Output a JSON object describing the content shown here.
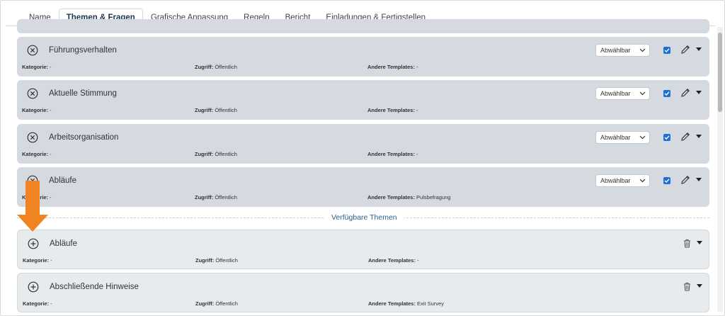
{
  "tabs": [
    {
      "label": "Name"
    },
    {
      "label": "Themen & Fragen"
    },
    {
      "label": "Grafische Anpassung"
    },
    {
      "label": "Regeln"
    },
    {
      "label": "Bericht"
    },
    {
      "label": "Einladungen & Fertigstellen"
    }
  ],
  "active_tab": "Themen & Fragen",
  "labels": {
    "kategorie": "Kategorie:",
    "zugriff": "Zugriff:",
    "andere_templates": "Andere Templates:"
  },
  "selected_topics": [
    {
      "title": "Führungsverhalten",
      "kategorie": " -",
      "zugriff": " Öffentlich",
      "andere_templates": " -",
      "option": "Abwählbar",
      "checked": true
    },
    {
      "title": "Aktuelle Stimmung",
      "kategorie": " -",
      "zugriff": " Öffentlich",
      "andere_templates": " -",
      "option": "Abwählbar",
      "checked": true
    },
    {
      "title": "Arbeitsorganisation",
      "kategorie": " -",
      "zugriff": " Öffentlich",
      "andere_templates": " -",
      "option": "Abwählbar",
      "checked": true
    },
    {
      "title": "Abläufe",
      "kategorie": " -",
      "zugriff": " Öffentlich",
      "andere_templates": " Pulsbefragung",
      "option": "Abwählbar",
      "checked": true
    }
  ],
  "divider_label": "Verfügbare Themen",
  "available_topics": [
    {
      "title": "Abläufe",
      "kategorie": " -",
      "zugriff": " Öffentlich",
      "andere_templates": " -"
    },
    {
      "title": "Abschließende Hinweise",
      "kategorie": " -",
      "zugriff": " Öffentlich",
      "andere_templates": " Exit Survey"
    }
  ],
  "colors": {
    "accent_blue": "#1d6fd6",
    "arrow_orange": "#f08422",
    "selected_card": "#d4dae0",
    "available_card": "#e8ebee"
  }
}
